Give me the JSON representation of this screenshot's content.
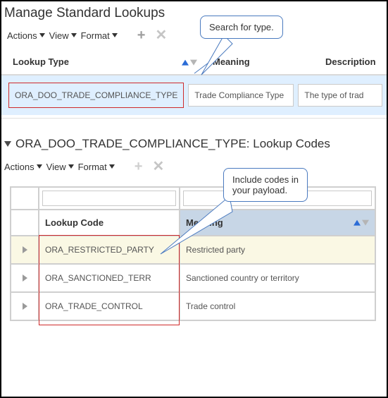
{
  "page_title": "Manage Standard Lookups",
  "toolbar": {
    "actions": "Actions",
    "view": "View",
    "format": "Format"
  },
  "upper": {
    "columns": {
      "lookup_type": "Lookup Type",
      "meaning": "Meaning",
      "description": "Description"
    },
    "row": {
      "lookup_type": "ORA_DOO_TRADE_COMPLIANCE_TYPE",
      "meaning": "Trade Compliance Type",
      "description": "The type of trad"
    }
  },
  "callout_upper": "Search for type.",
  "section_title": "ORA_DOO_TRADE_COMPLIANCE_TYPE: Lookup Codes",
  "callout_lower_line1": "Include codes in",
  "callout_lower_line2": "your payload.",
  "lower": {
    "columns": {
      "lookup_code": "Lookup Code",
      "meaning": "Meaning"
    },
    "rows": [
      {
        "code": "ORA_RESTRICTED_PARTY",
        "meaning": "Restricted party"
      },
      {
        "code": "ORA_SANCTIONED_TERR",
        "meaning": "Sanctioned country or territory"
      },
      {
        "code": "ORA_TRADE_CONTROL",
        "meaning": "Trade control"
      }
    ]
  }
}
